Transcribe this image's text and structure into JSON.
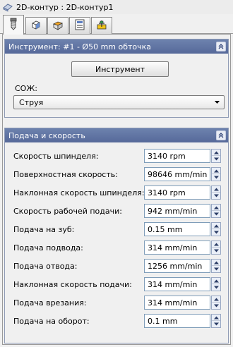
{
  "window": {
    "title": "2D-контур : 2D-контур1",
    "title_icon": "contour-icon"
  },
  "tabs": [
    {
      "icon": "tool-icon",
      "active": true
    },
    {
      "icon": "cube-icon",
      "active": false
    },
    {
      "icon": "stock-box-icon",
      "active": false
    },
    {
      "icon": "list-icon",
      "active": false
    },
    {
      "icon": "origin-icon",
      "active": false
    }
  ],
  "tool_panel": {
    "header": "Инструмент: #1 - Ø50 mm обточка",
    "tool_button": "Инструмент",
    "coolant_label": "СОЖ:",
    "coolant_value": "Струя"
  },
  "feed_panel": {
    "header": "Подача и скорость",
    "rows": [
      {
        "label": "Скорость шпинделя:",
        "value": "3140 rpm"
      },
      {
        "label": "Поверхностная скорость:",
        "value": "98646 mm/min"
      },
      {
        "label": "Наклонная скорость шпинделя:",
        "value": "3140 rpm"
      },
      {
        "label": "Скорость рабочей подачи:",
        "value": "942 mm/min"
      },
      {
        "label": "Подача на зуб:",
        "value": "0.15 mm"
      },
      {
        "label": "Подача подвода:",
        "value": "314 mm/min"
      },
      {
        "label": "Подача отвода:",
        "value": "1256 mm/min"
      },
      {
        "label": "Наклонная скорость подачи:",
        "value": "314 mm/min"
      },
      {
        "label": "Подача врезания:",
        "value": "314 mm/min"
      },
      {
        "label": "Подача на оборот:",
        "value": "0.1 mm"
      }
    ]
  },
  "colors": {
    "panel_header": "#6177a6",
    "panel_header_text": "#ffffff",
    "background": "#f0f0f0"
  }
}
